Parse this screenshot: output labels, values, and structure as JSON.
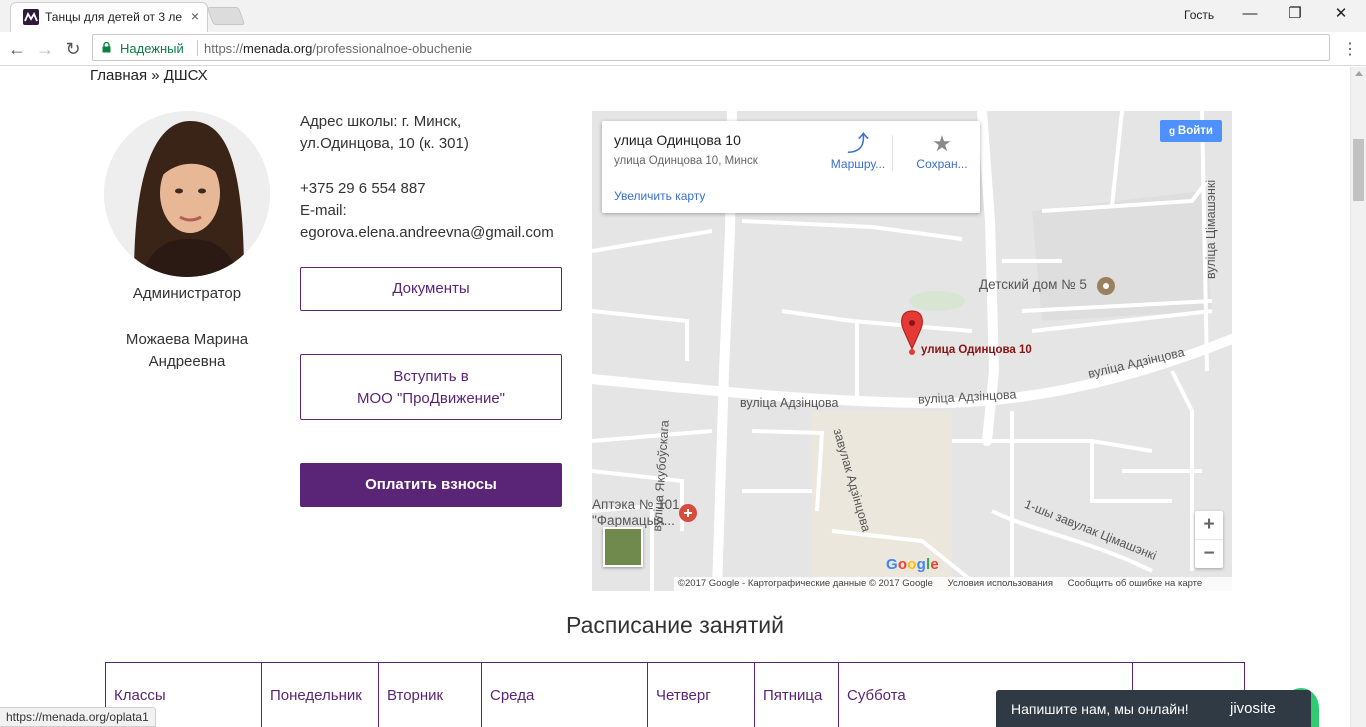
{
  "browser": {
    "tab_title": "Танцы для детей от 3 ле",
    "tab_close": "×",
    "profile": "Гость",
    "min": "—",
    "restore": "❐",
    "close": "✕",
    "back": "←",
    "forward": "→",
    "reload": "↻",
    "secure_label": "Надежный",
    "url_scheme": "https://",
    "url_host": "menada.org",
    "url_path": "/professionalnoe-obuchenie",
    "menu": "⋮"
  },
  "breadcrumb": "Главная » ДШСХ",
  "admin": {
    "role": "Администратор",
    "name_line1": "Можаева Марина",
    "name_line2": "Андреевна"
  },
  "contacts": {
    "address_line1": "Адрес школы: г. Минск,",
    "address_line2": "ул.Одинцова, 10 (к. 301)",
    "phone": "+375 29 6 554 887",
    "email_label": "E-mail:",
    "email": "egorova.elena.andreevna@gmail.com"
  },
  "buttons": {
    "documents": "Документы",
    "join_line1": "Вступить в",
    "join_line2": "МОО \"ПроДвижение\"",
    "pay": "Оплатить взносы"
  },
  "map": {
    "place_title": "улица Одинцова 10",
    "place_address": "улица Одинцова 10, Минск",
    "enlarge": "Увеличить карту",
    "route": "Маршру...",
    "save": "Сохран...",
    "signin": "Войти",
    "marker_label": "улица Одинцова 10",
    "poi_orphanage": "Детский дом № 5",
    "poi_pharmacy_line1": "Аптэка № 101",
    "poi_pharmacy_line2": "\"Фармацыя...",
    "street_adzintsova_1": "вуліца Адзінцова",
    "street_adzintsova_2": "вуліца Адзінцова",
    "street_adzintsova_3": "вуліца Адзінцова",
    "street_yakubouskaga": "вуліца Якубоўскага",
    "street_lane_adzintsova": "завулак Адзінцова",
    "street_timashenki": "вуліца Цімашэнкі",
    "street_lane_timashenki": "1-шы завулак Цімашэнкі",
    "zoom_in": "+",
    "zoom_out": "−",
    "google": "Google",
    "attrib_copyright": "©2017 Google - Картографические данные © 2017 Google",
    "attrib_terms": "Условия использования",
    "attrib_report": "Сообщить об ошибке на карте"
  },
  "schedule": {
    "title": "Расписание занятий",
    "columns": [
      "Классы",
      "Понедельник",
      "Вторник",
      "Среда",
      "Четверг",
      "Пятница",
      "Суббота",
      ""
    ]
  },
  "status_url": "https://menada.org/oplata1",
  "chat": {
    "message": "Напишите нам, мы онлайн!",
    "brand": "jivosite"
  },
  "colors": {
    "brand_purple": "#5b2577",
    "secure_green": "#0b8043",
    "chat_bg": "#2f3a45",
    "chat_accent": "#2fcc71",
    "map_marker": "#e53935"
  }
}
